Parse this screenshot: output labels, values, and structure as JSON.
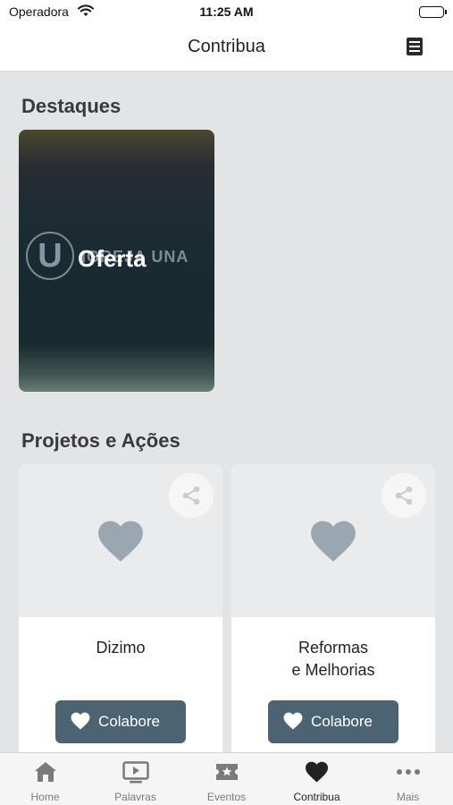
{
  "status_bar": {
    "carrier": "Operadora",
    "time": "11:25 AM"
  },
  "nav": {
    "title": "Contribua",
    "menu_icon": "list-icon"
  },
  "highlights": {
    "section_title": "Destaques",
    "card": {
      "label": "Oferta",
      "logo_letter": "U",
      "logo_text": "IGREJA UNA"
    }
  },
  "projects": {
    "section_title": "Projetos e Ações",
    "items": [
      {
        "title_line1": "Dizimo",
        "title_line2": "",
        "button_label": "Colabore"
      },
      {
        "title_line1": "Reformas",
        "title_line2": "e Melhorias",
        "button_label": "Colabore"
      }
    ]
  },
  "tab_bar": {
    "active": "Contribua",
    "tabs": [
      {
        "label": "Home",
        "icon": "home-icon"
      },
      {
        "label": "Palavras",
        "icon": "play-icon"
      },
      {
        "label": "Eventos",
        "icon": "ticket-icon"
      },
      {
        "label": "Contribua",
        "icon": "heart-icon"
      },
      {
        "label": "Mais",
        "icon": "more-icon"
      }
    ]
  },
  "colors": {
    "accent": "#4c6372",
    "heart_placeholder": "#9aa7b1",
    "background": "#e3e4e6"
  }
}
